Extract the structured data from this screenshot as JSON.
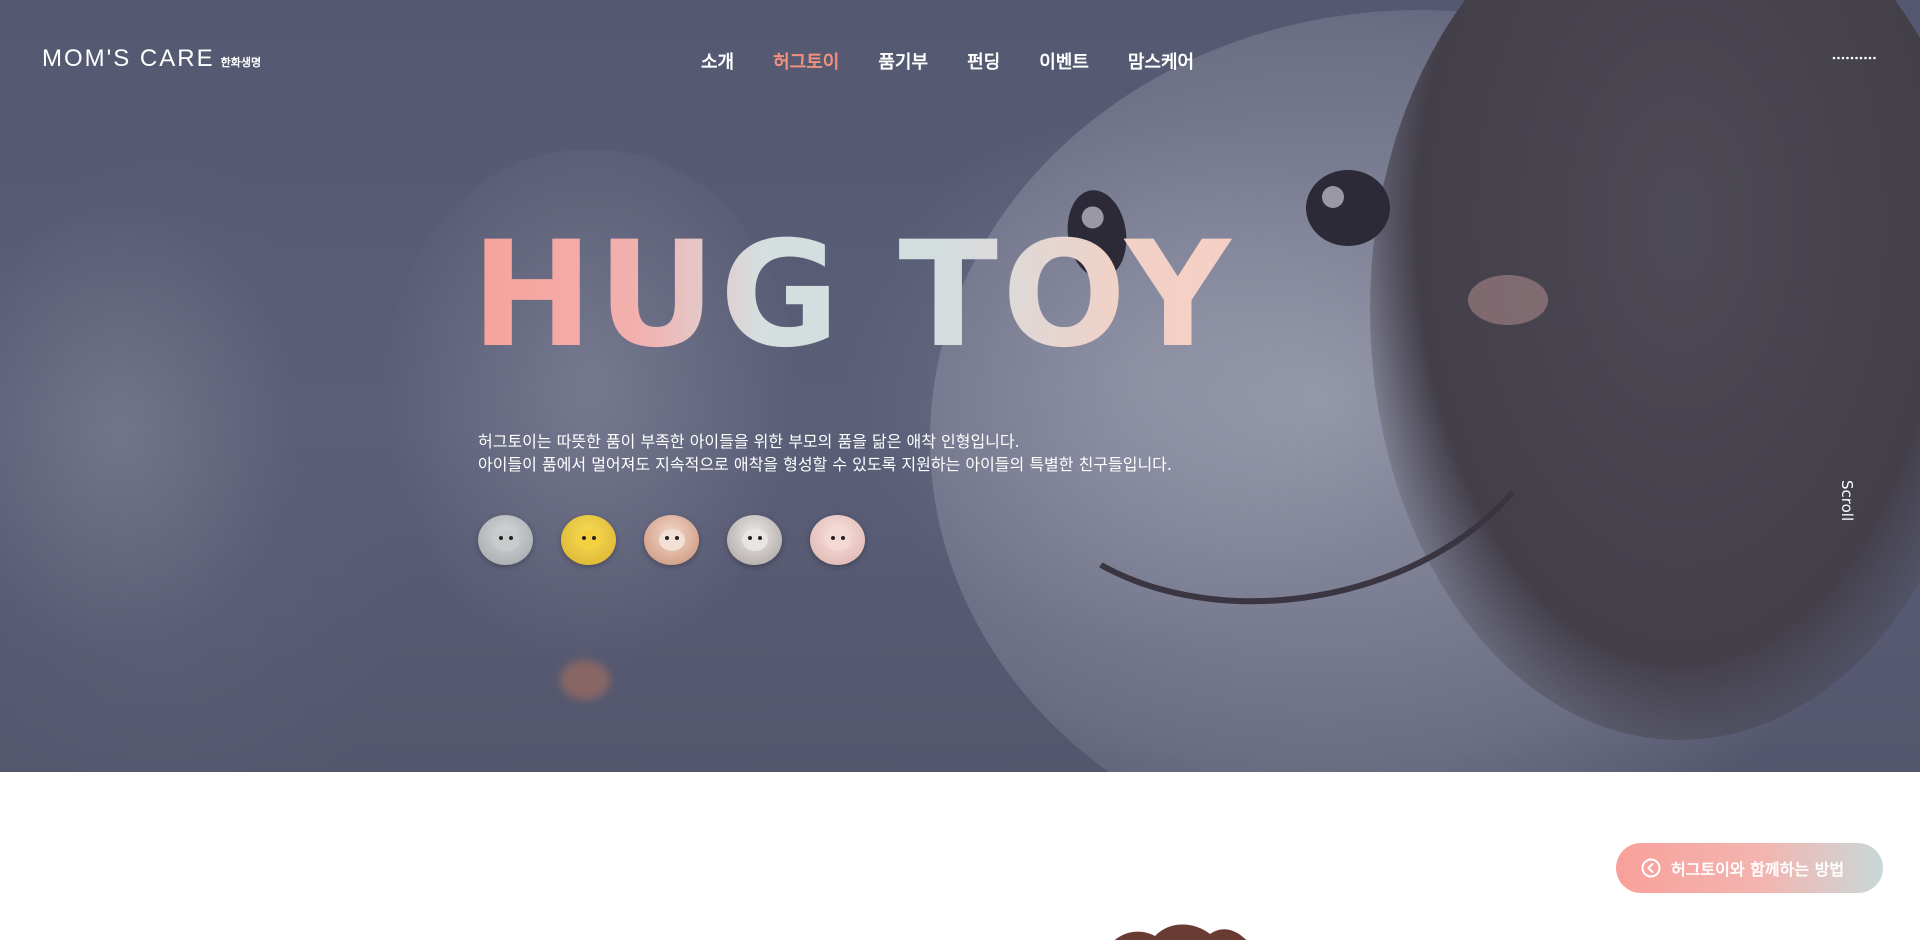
{
  "header": {
    "logo_text": "MOM'S CARE",
    "logo_sub": "한화생명",
    "nav": [
      {
        "label": "소개",
        "active": false
      },
      {
        "label": "허그토이",
        "active": true
      },
      {
        "label": "품기부",
        "active": false
      },
      {
        "label": "펀딩",
        "active": false
      },
      {
        "label": "이벤트",
        "active": false
      },
      {
        "label": "맘스케어",
        "active": false
      }
    ],
    "menu_icon": "dotted-menu-icon"
  },
  "hero": {
    "title": "HUG TOY",
    "desc_line1": "허그토이는 따뜻한 품이 부족한 아이들을 위한 부모의 품을 닮은 애착 인형입니다.",
    "desc_line2": "아이들이 품에서 멀어져도 지속적으로 애착을 형성할 수 있도록 지원하는 아이들의 특별한 친구들입니다.",
    "toys": [
      {
        "icon": "gray-bear-toy-icon",
        "color": "#b9bdbf"
      },
      {
        "icon": "yellow-duck-toy-icon",
        "color": "#f1cc3a"
      },
      {
        "icon": "brown-hair-doll-toy-icon",
        "color": "#e7b6a2"
      },
      {
        "icon": "husky-dog-toy-icon",
        "color": "#d8d4d2"
      },
      {
        "icon": "pink-bear-toy-icon",
        "color": "#f0d0cc"
      }
    ],
    "scroll_label": "Scroll"
  },
  "floating_button": {
    "label": "허그토이와 함께하는 방법",
    "icon": "chevron-left-circle-icon"
  },
  "colors": {
    "accent": "#f1917e",
    "hero_bg": "#565a72"
  }
}
